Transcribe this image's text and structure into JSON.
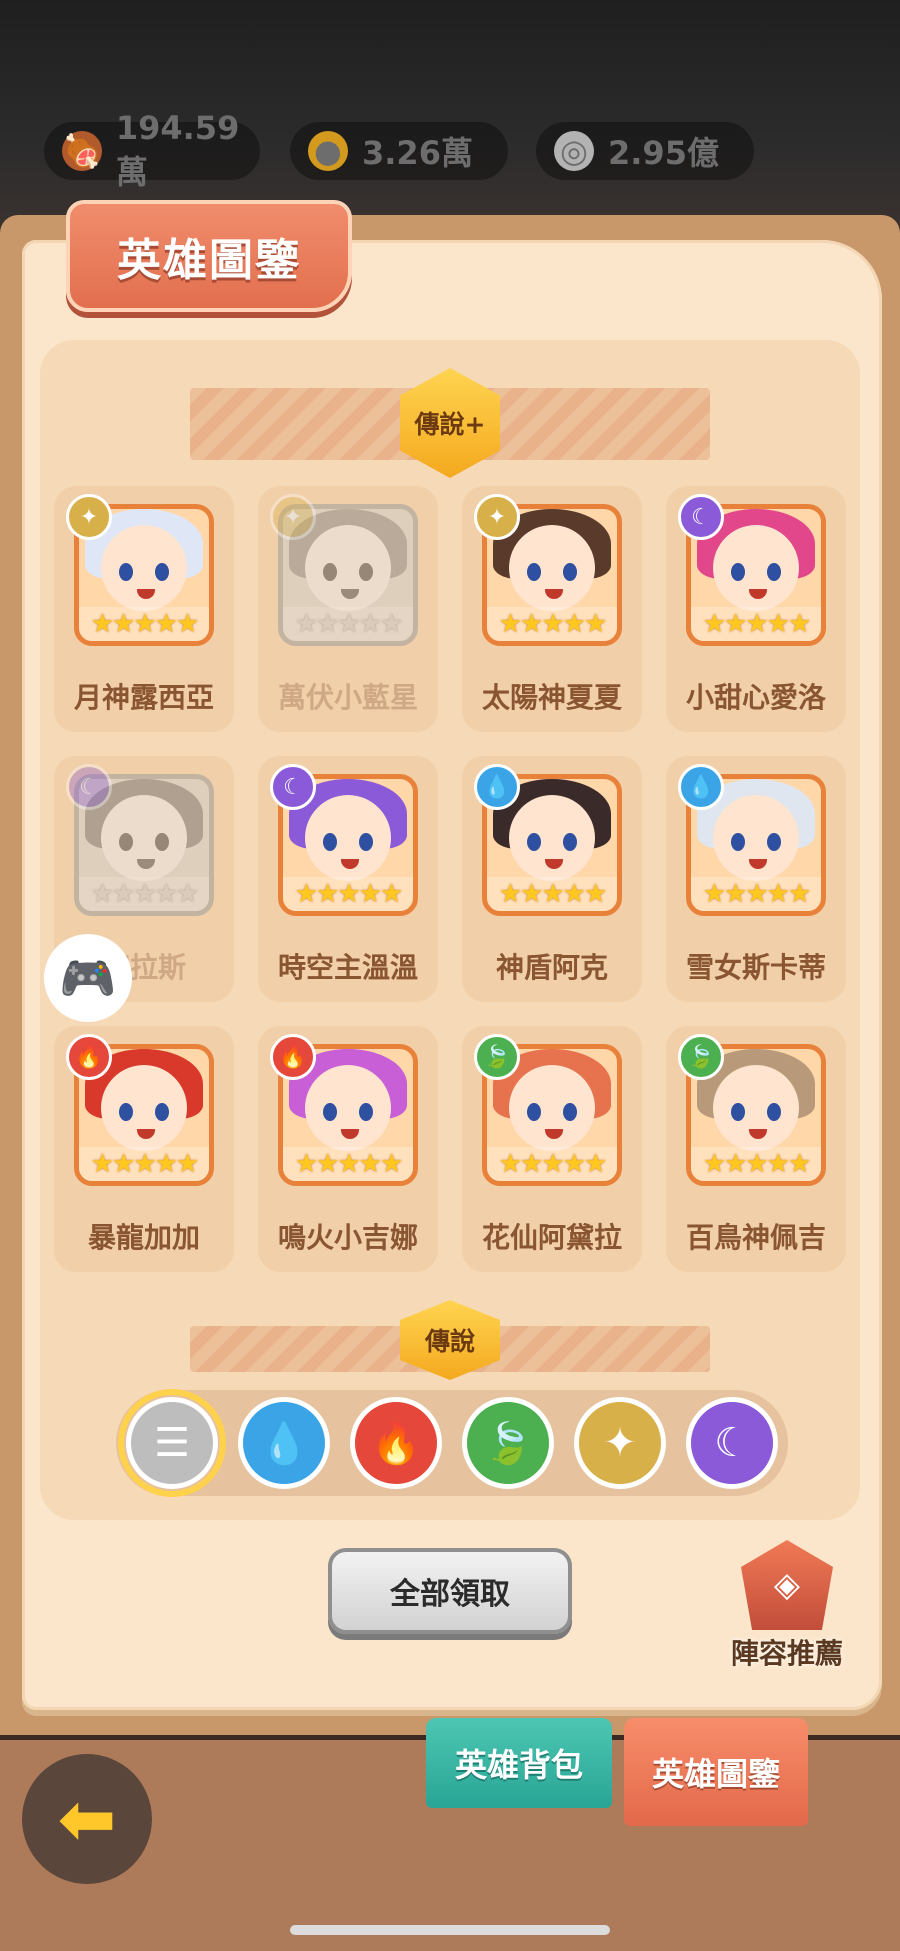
{
  "resources": [
    {
      "icon": "meat-icon",
      "value": "194.59萬",
      "color": "#b15a2c"
    },
    {
      "icon": "gold-coins-icon",
      "value": "3.26萬",
      "color": "#d39a1d"
    },
    {
      "icon": "gem-coin-icon",
      "value": "2.95億",
      "color": "#b3b3b3"
    }
  ],
  "header": {
    "title": "英雄圖鑒"
  },
  "sections": {
    "legend_plus": "傳說+",
    "legend": "傳說"
  },
  "heroes": [
    {
      "name": "月神露西亞",
      "element": "light",
      "owned": true,
      "hair": "#dfe7f6"
    },
    {
      "name": "萬伏小藍星",
      "element": "light",
      "owned": false,
      "hair": "#8c8c8c"
    },
    {
      "name": "太陽神夏夏",
      "element": "light",
      "owned": true,
      "hair": "#5a3a2a"
    },
    {
      "name": "小甜心愛洛",
      "element": "dark",
      "owned": true,
      "hair": "#e2478c"
    },
    {
      "name": "塞拉斯",
      "element": "dark",
      "owned": false,
      "hair": "#7a7a7a"
    },
    {
      "name": "時空主溫溫",
      "element": "dark",
      "owned": true,
      "hair": "#8a5ad8"
    },
    {
      "name": "神盾阿克",
      "element": "water",
      "owned": true,
      "hair": "#3a2a2a"
    },
    {
      "name": "雪女斯卡蒂",
      "element": "water",
      "owned": true,
      "hair": "#dfe6f0"
    },
    {
      "name": "暴龍加加",
      "element": "fire",
      "owned": true,
      "hair": "#d8392b"
    },
    {
      "name": "鳴火小吉娜",
      "element": "fire",
      "owned": true,
      "hair": "#c85fd6"
    },
    {
      "name": "花仙阿黛拉",
      "element": "nature",
      "owned": true,
      "hair": "#e6734d"
    },
    {
      "name": "百鳥神佩吉",
      "element": "nature",
      "owned": true,
      "hair": "#b89a7a"
    }
  ],
  "element_colors": {
    "light": "#d8b04a",
    "dark": "#8a5ad8",
    "water": "#3ba4e6",
    "fire": "#e5483b",
    "nature": "#4caf50"
  },
  "filters": [
    {
      "icon": "list-icon",
      "selected": true,
      "color": "#bdbdbd"
    },
    {
      "icon": "water-drop-icon",
      "selected": false,
      "color": "#3ba4e6"
    },
    {
      "icon": "fire-icon",
      "selected": false,
      "color": "#e5483b"
    },
    {
      "icon": "leaf-icon",
      "selected": false,
      "color": "#4caf50"
    },
    {
      "icon": "light-icon",
      "selected": false,
      "color": "#d8b04a"
    },
    {
      "icon": "moon-icon",
      "selected": false,
      "color": "#8a5ad8"
    }
  ],
  "actions": {
    "claim_all": "全部領取",
    "lineup": "陣容推薦"
  },
  "tabs": {
    "bag": "英雄背包",
    "codex": "英雄圖鑒"
  }
}
